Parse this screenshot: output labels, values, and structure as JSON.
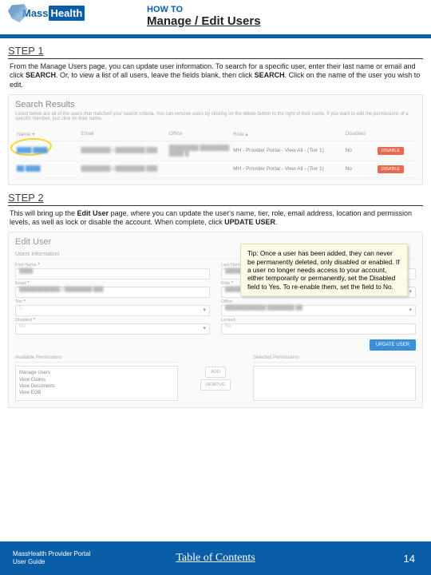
{
  "brand": {
    "mass": "Mass",
    "health": "Health"
  },
  "header": {
    "howto": "HOW TO",
    "title": "Manage / Edit Users"
  },
  "step1": {
    "heading": "STEP 1",
    "text_parts": {
      "p1": "From the Manage Users page, you can update user information. To search for a specific user, enter their last name or email and click ",
      "b1": "SEARCH",
      "p2": ". Or, to view a list of all users, leave the fields blank, then click ",
      "b2": "SEARCH",
      "p3": ". Click on the name of the user you wish to edit."
    }
  },
  "search_results": {
    "title": "Search Results",
    "desc": "Listed below are all of the users that matched your search criteria. You can remove users by clicking on the delete button to the right of their name. If you want to edit the permissions of a specific member, just click on their name.",
    "headers": {
      "name": "Name ▾",
      "email": "Email",
      "office": "Office",
      "role": "Role ▴",
      "disabled": "Disabled"
    },
    "rows": [
      {
        "name": "████ ████",
        "email": "████████@████████.███",
        "office": "████████ ████████ ████ █",
        "role": "MH - Provider Portal - View All - (Tier 1)",
        "disabled": "No",
        "action": "DISABLE"
      },
      {
        "name": "██ ████",
        "email": "████████@████████.███",
        "office": "",
        "role": "MH - Provider Portal - View All - (Tier 1)",
        "disabled": "No",
        "action": "DISABLE"
      }
    ]
  },
  "step2": {
    "heading": "STEP 2",
    "text_parts": {
      "p1": "This will bring up the ",
      "b1": "Edit User",
      "p2": " page, where you can update the user's name, tier, role, email address, location and permission levels, as well as lock or disable the account. When complete, click ",
      "b2": "UPDATE USER",
      "p3": "."
    }
  },
  "edit_user": {
    "title": "Edit User",
    "section": "Users Information",
    "fields": {
      "first_name": {
        "label": "First Name",
        "value": "████"
      },
      "last_name": {
        "label": "Last Name",
        "value": "████████"
      },
      "email": {
        "label": "Email",
        "value": "████████████@████████.███"
      },
      "role": {
        "label": "Role",
        "value": "████████████ ████████ ██"
      },
      "tier": {
        "label": "Tier",
        "value": "1"
      },
      "office": {
        "label": "Office",
        "value": "████████████ ████████ ██"
      },
      "disabled": {
        "label": "Disabled",
        "value": "No"
      },
      "locked": {
        "label": "Locked",
        "value": "No"
      }
    },
    "update": "UPDATE USER",
    "perm": {
      "available_label": "Available Permissions",
      "selected_label": "Selected Permissions",
      "available": [
        "Manage Users",
        "View Claims",
        "View Documents",
        "View EOB"
      ],
      "add": "ADD",
      "remove": "REMOVE"
    }
  },
  "tip": "Tip: Once a user has been added, they can never be permanently deleted, only disabled or enabled. If a user no longer needs access to your account, either temporarily or permanently, set the Disabled field to Yes. To re-enable them, set the field to No.",
  "footer": {
    "guide_line1": "MassHealth Provider Portal",
    "guide_line2": "User Guide",
    "toc": "Table of Contents",
    "page": "14"
  }
}
